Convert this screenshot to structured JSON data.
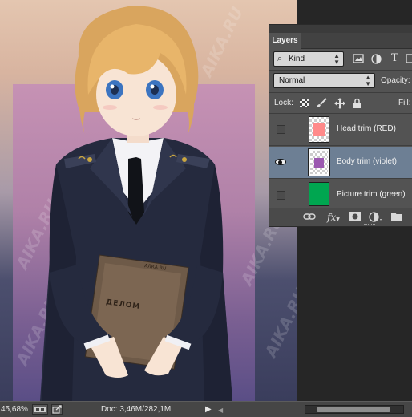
{
  "canvas": {
    "watermark_text": "AIKA.RU",
    "folder_label": "АЛКА.RU",
    "folder_title": "ДЕЛОМ"
  },
  "layers_panel": {
    "tab_label": "Layers",
    "filter_kind": "Kind",
    "blend_mode": "Normal",
    "opacity_label": "Opacity:",
    "lock_label": "Lock:",
    "fill_label": "Fill:",
    "layers": [
      {
        "name": "Head trim (RED)",
        "visible": false,
        "selected": false,
        "swatch_color": "#ff8a8a",
        "full_fill": false
      },
      {
        "name": "Body trim (violet)",
        "visible": true,
        "selected": true,
        "swatch_color": "#9b59b0",
        "full_fill": false
      },
      {
        "name": "Picture trim (green)",
        "visible": false,
        "selected": false,
        "swatch_color": "#00a650",
        "full_fill": true
      }
    ],
    "footer_icons": [
      "link-icon",
      "fx-icon",
      "mask-icon",
      "adjustment-icon",
      "folder-icon"
    ],
    "footer_fx_label": "fx"
  },
  "statusbar": {
    "zoom": "45,68%",
    "doc_label": "Doc: 3,46M/282,1M"
  },
  "colors": {
    "panel_bg": "#535353",
    "selected_row": "#6d7f94",
    "canvas_trim": "#b081a8"
  }
}
